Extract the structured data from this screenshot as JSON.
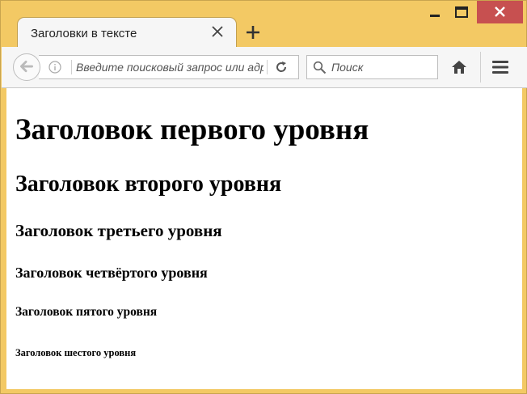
{
  "tab": {
    "title": "Заголовки в тексте"
  },
  "toolbar": {
    "url_placeholder": "Введите поисковый запрос или адрес",
    "search_placeholder": "Поиск"
  },
  "icons": {
    "back": "back-arrow-icon",
    "info": "info-icon",
    "reload": "reload-icon",
    "search": "search-icon",
    "home": "home-icon",
    "menu": "hamburger-menu-icon"
  },
  "colors": {
    "frame": "#f3c964",
    "close_button": "#c75050",
    "toolbar_bg": "#f6f6f6"
  },
  "page": {
    "h1": "Заголовок первого уровня",
    "h2": "Заголовок второго уровня",
    "h3": "Заголовок третьего уровня",
    "h4": "Заголовок четвёртого уровня",
    "h5": "Заголовок пятого уровня",
    "h6": "Заголовок шестого уровня"
  }
}
